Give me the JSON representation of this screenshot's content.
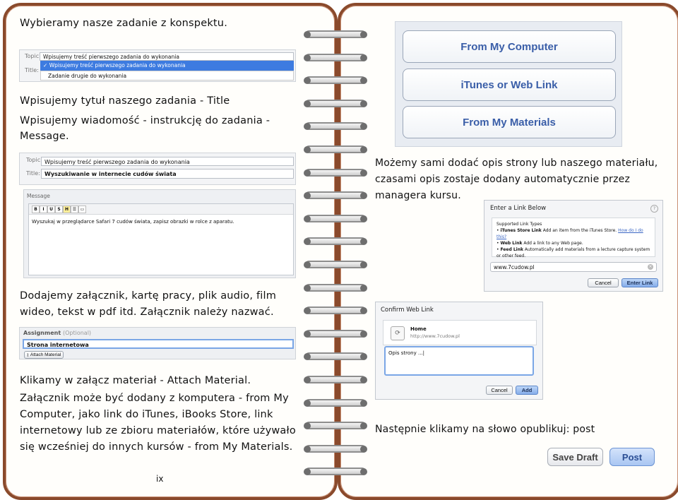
{
  "left": {
    "text1": "Wybieramy nasze zadanie z konspektu.",
    "topic_label": "Topic:",
    "title_label": "Title:",
    "topic_value": "Wpisujemy treść pierwszego zadania do wykonania",
    "dropdown_option1": "Wpisujemy treść pierwszego zadania do wykonania",
    "dropdown_option2": "Zadanie drugie do wykonania",
    "check": "✓",
    "text2": "Wpisujemy tytuł naszego zadania - Title",
    "text3_line1": "Wpisujemy wiadomość - instrukcję do zadania -",
    "text3_line2": "Message.",
    "topic_label2": "Topic:",
    "title_label2": "Title:",
    "topic_value2": "Wpisujemy treść pierwszego zadania do wykonania",
    "title_value2": "Wyszukiwanie w internecie cudów świata",
    "message_label": "Message",
    "message_text": "Wyszukaj w przeglądarce Safari 7 cudów świata, zapisz obrazki w rolce z aparatu.",
    "toolbar": [
      "B",
      "I",
      "U",
      "S",
      "H",
      "☰",
      "▭"
    ],
    "text4_line1": "Dodajemy załącznik, kartę pracy, plik audio, film",
    "text4_line2": "wideo, tekst w pdf itd. Załącznik należy nazwać.",
    "assignment_label": "Assignment",
    "assignment_optional": "(Optional)",
    "assignment_value": "Strona internetowa",
    "attach_button": "Attach Material",
    "text5": "Klikamy w załącz materiał - Attach Material.",
    "text6_line1": "Załącznik może być dodany z komputera - from My",
    "text6_line2": "Computer, jako link do iTunes, iBooks Store, link",
    "text6_line3": "internetowy lub ze zbioru materiałów, które używało",
    "text6_line4": "się wcześniej do innych kursów - from My Materials.",
    "page_number": "ix"
  },
  "right": {
    "btn_computer": "From My Computer",
    "btn_itunes": "iTunes or Web Link",
    "btn_materials": "From My Materials",
    "text1_line1": "Możemy sami dodać opis strony lub naszego materiału,",
    "text1_line2": "czasami opis zostaje dodany automatycznie przez",
    "text1_line3": "managera kursu.",
    "link_dialog_title": "Enter a Link Below",
    "supported_types": "Supported Link Types",
    "type1_bold": "iTunes Store Link",
    "type1_text": " Add an item from the iTunes Store.",
    "type1_link": "How do I do this?",
    "type2_bold": "Web Link",
    "type2_text": " Add a link to any Web page.",
    "type3_bold": "Feed Link",
    "type3_text": " Automatically add materials from a lecture capture system or other feed.",
    "link_value": "www.7cudow.pl",
    "cancel1": "Cancel",
    "enter_link": "Enter Link",
    "confirm_title": "Confirm Web Link",
    "home_label": "Home",
    "home_url": "http://www.7cudow.pl",
    "description": "Opis strony ...|",
    "cancel2": "Cancel",
    "add": "Add",
    "text2": "Następnie klikamy na słowo opublikuj: post",
    "save_draft": "Save Draft",
    "post": "Post"
  }
}
